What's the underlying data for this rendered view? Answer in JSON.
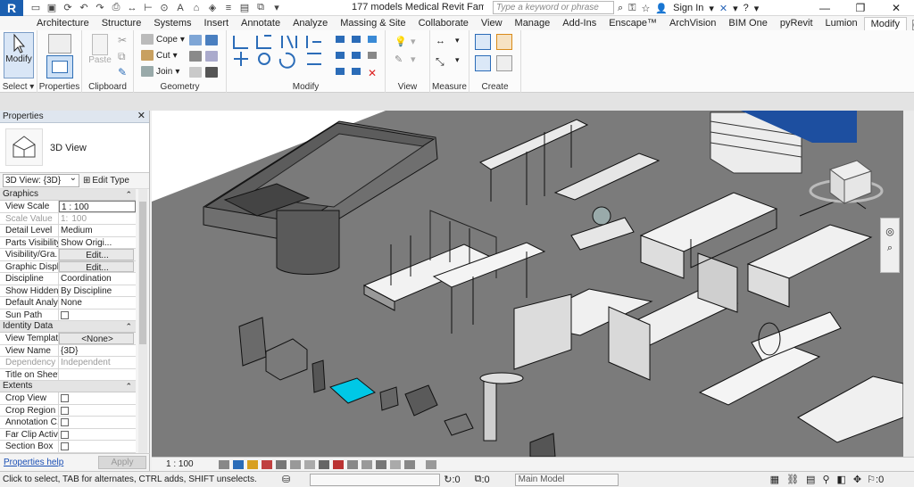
{
  "app": {
    "logo": "R",
    "title": "177 models Medical Revit Families...",
    "search_placeholder": "Type a keyword or phrase",
    "sign_in": "Sign In"
  },
  "tabs": [
    "Architecture",
    "Structure",
    "Systems",
    "Insert",
    "Annotate",
    "Analyze",
    "Massing & Site",
    "Collaborate",
    "View",
    "Manage",
    "Add-Ins",
    "Enscape™",
    "ArchVision",
    "BIM One",
    "pyRevit",
    "Lumion",
    "Modify"
  ],
  "ribbon": {
    "select": {
      "modify_label": "Modify",
      "panel_label": "Select ▾"
    },
    "properties": {
      "panel_label": "Properties"
    },
    "clipboard": {
      "paste_label": "Paste",
      "panel_label": "Clipboard"
    },
    "geometry": {
      "cope_label": "Cope",
      "cut_label": "Cut",
      "join_label": "Join",
      "panel_label": "Geometry"
    },
    "modify": {
      "panel_label": "Modify"
    },
    "view": {
      "panel_label": "View"
    },
    "measure": {
      "panel_label": "Measure"
    },
    "create": {
      "panel_label": "Create"
    }
  },
  "properties": {
    "title": "Properties",
    "type_name": "3D View",
    "type_selector": "3D View: {3D}",
    "edit_type": "Edit Type",
    "groups": [
      {
        "name": "Graphics",
        "rows": [
          {
            "name": "View Scale",
            "value": "1 : 100",
            "style": "boxed"
          },
          {
            "name": "Scale Value",
            "value": "100",
            "prefix": "1:",
            "style": "dim"
          },
          {
            "name": "Detail Level",
            "value": "Medium"
          },
          {
            "name": "Parts Visibility",
            "value": "Show Origi..."
          },
          {
            "name": "Visibility/Gra...",
            "value": "Edit...",
            "style": "btn"
          },
          {
            "name": "Graphic Displ...",
            "value": "Edit...",
            "style": "btn"
          },
          {
            "name": "Discipline",
            "value": "Coordination"
          },
          {
            "name": "Show Hidden...",
            "value": "By Discipline"
          },
          {
            "name": "Default Analy...",
            "value": "None"
          },
          {
            "name": "Sun Path",
            "value": "",
            "style": "check"
          }
        ]
      },
      {
        "name": "Identity Data",
        "rows": [
          {
            "name": "View Template",
            "value": "<None>",
            "style": "btn"
          },
          {
            "name": "View Name",
            "value": "{3D}"
          },
          {
            "name": "Dependency",
            "value": "Independent",
            "style": "dim"
          },
          {
            "name": "Title on Sheet",
            "value": ""
          }
        ]
      },
      {
        "name": "Extents",
        "rows": [
          {
            "name": "Crop View",
            "value": "",
            "style": "check"
          },
          {
            "name": "Crop Region ...",
            "value": "",
            "style": "check"
          },
          {
            "name": "Annotation C...",
            "value": "",
            "style": "check"
          },
          {
            "name": "Far Clip Active",
            "value": "",
            "style": "check"
          },
          {
            "name": "Section Box",
            "value": "",
            "style": "check"
          }
        ]
      }
    ],
    "help_link": "Properties help",
    "apply": "Apply"
  },
  "view_control": {
    "scale": "1 : 100"
  },
  "status": {
    "message": "Click to select, TAB for alternates, CTRL adds, SHIFT unselects.",
    "zero_a": ":0",
    "zero_b": ":0",
    "model": "Main Model",
    "filter_count": ":0"
  },
  "colors": {
    "accent": "#1b5fb0",
    "viewport_bg": "#7b7b7b",
    "ribbon_bg": "#fbfbfb",
    "selection": "#00c8e6"
  }
}
